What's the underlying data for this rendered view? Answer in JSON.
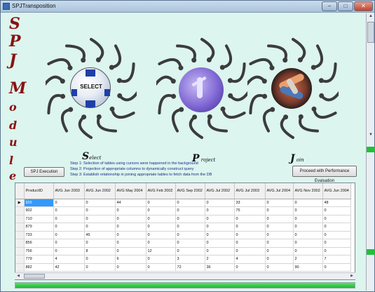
{
  "window": {
    "title": "SPJTransposition"
  },
  "side_letters": [
    "S",
    "P",
    "J",
    "M",
    "o",
    "d",
    "u",
    "l",
    "e"
  ],
  "operations": [
    {
      "key": "select",
      "big": "S",
      "rest": "elect",
      "image": "soccer-ball",
      "ball_text": "SELECT"
    },
    {
      "key": "project",
      "big": "P",
      "rest": " roject",
      "image": "violet-planet"
    },
    {
      "key": "join",
      "big": "J",
      "rest": " oin",
      "image": "knot-globe"
    }
  ],
  "buttons": {
    "execute": "SPJ Execution",
    "proceed": "Proceed with Performance Evaluation"
  },
  "steps": [
    "Step 1: Selection of tables using cursors were happened in the background",
    "Step 2: Projection of appropriate columns to dynamically construct query",
    "Step 3: Establish relationship in joining appropriate tables to fetch data from the DB"
  ],
  "grid": {
    "columns": [
      "ProductID",
      "AVG Jun 2003",
      "AVG Jun 2002",
      "AVG May 2004",
      "AVG Feb 2002",
      "AVG Sep 2002",
      "AVG Jul 2002",
      "AVG Jul 2003",
      "AVG Jul 2004",
      "AVG Nov 2002",
      "AVG Jun 2004"
    ],
    "rows": [
      [
        "925",
        "0",
        "0",
        "44",
        "0",
        "0",
        "0",
        "33",
        "0",
        "0",
        "48"
      ],
      [
        "902",
        "0",
        "0",
        "0",
        "0",
        "0",
        "0",
        "75",
        "0",
        "0",
        "0"
      ],
      [
        "710",
        "0",
        "0",
        "0",
        "0",
        "0",
        "0",
        "0",
        "0",
        "0",
        "0"
      ],
      [
        "879",
        "0",
        "0",
        "0",
        "0",
        "0",
        "0",
        "0",
        "0",
        "0",
        "0"
      ],
      [
        "733",
        "0",
        "45",
        "0",
        "0",
        "0",
        "0",
        "0",
        "0",
        "0",
        "0"
      ],
      [
        "856",
        "0",
        "0",
        "0",
        "0",
        "0",
        "0",
        "0",
        "0",
        "0",
        "0"
      ],
      [
        "756",
        "0",
        "8",
        "0",
        "12",
        "0",
        "0",
        "0",
        "0",
        "0",
        "0"
      ],
      [
        "779",
        "4",
        "0",
        "6",
        "0",
        "3",
        "2",
        "4",
        "0",
        "2",
        "7"
      ],
      [
        "882",
        "42",
        "0",
        "0",
        "0",
        "72",
        "36",
        "0",
        "0",
        "90",
        "0"
      ]
    ]
  },
  "progress": {
    "value": 1.0
  },
  "colors": {
    "accent_red": "#8a1212",
    "progress_green": "#20c03a",
    "background": "#dcf5ee"
  }
}
